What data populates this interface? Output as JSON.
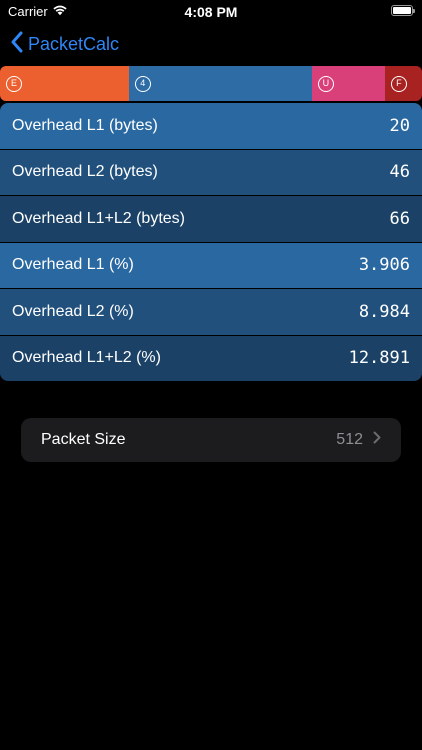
{
  "status_bar": {
    "carrier": "Carrier",
    "time": "4:08 PM"
  },
  "nav": {
    "back_label": "PacketCalc"
  },
  "segments": [
    {
      "letter": "E",
      "color": "#ec5f2e",
      "fraction": 0.305
    },
    {
      "letter": "4",
      "color": "#2e6ca6",
      "fraction": 0.434
    },
    {
      "letter": "U",
      "color": "#d9407a",
      "fraction": 0.173
    },
    {
      "letter": "F",
      "color": "#a82222",
      "fraction": 0.088
    }
  ],
  "overhead": {
    "rows": [
      {
        "label": "Overhead L1 (bytes)",
        "value": "20"
      },
      {
        "label": "Overhead L2 (bytes)",
        "value": "46"
      },
      {
        "label": "Overhead L1+L2 (bytes)",
        "value": "66"
      },
      {
        "label": "Overhead L1 (%)",
        "value": "3.906"
      },
      {
        "label": "Overhead L2 (%)",
        "value": "8.984"
      },
      {
        "label": "Overhead L1+L2 (%)",
        "value": "12.891"
      }
    ]
  },
  "packet": {
    "label": "Packet Size",
    "value": "512"
  },
  "colors": {
    "accent": "#2f86f6",
    "background": "#000000",
    "cell": "#1c1c1e"
  }
}
